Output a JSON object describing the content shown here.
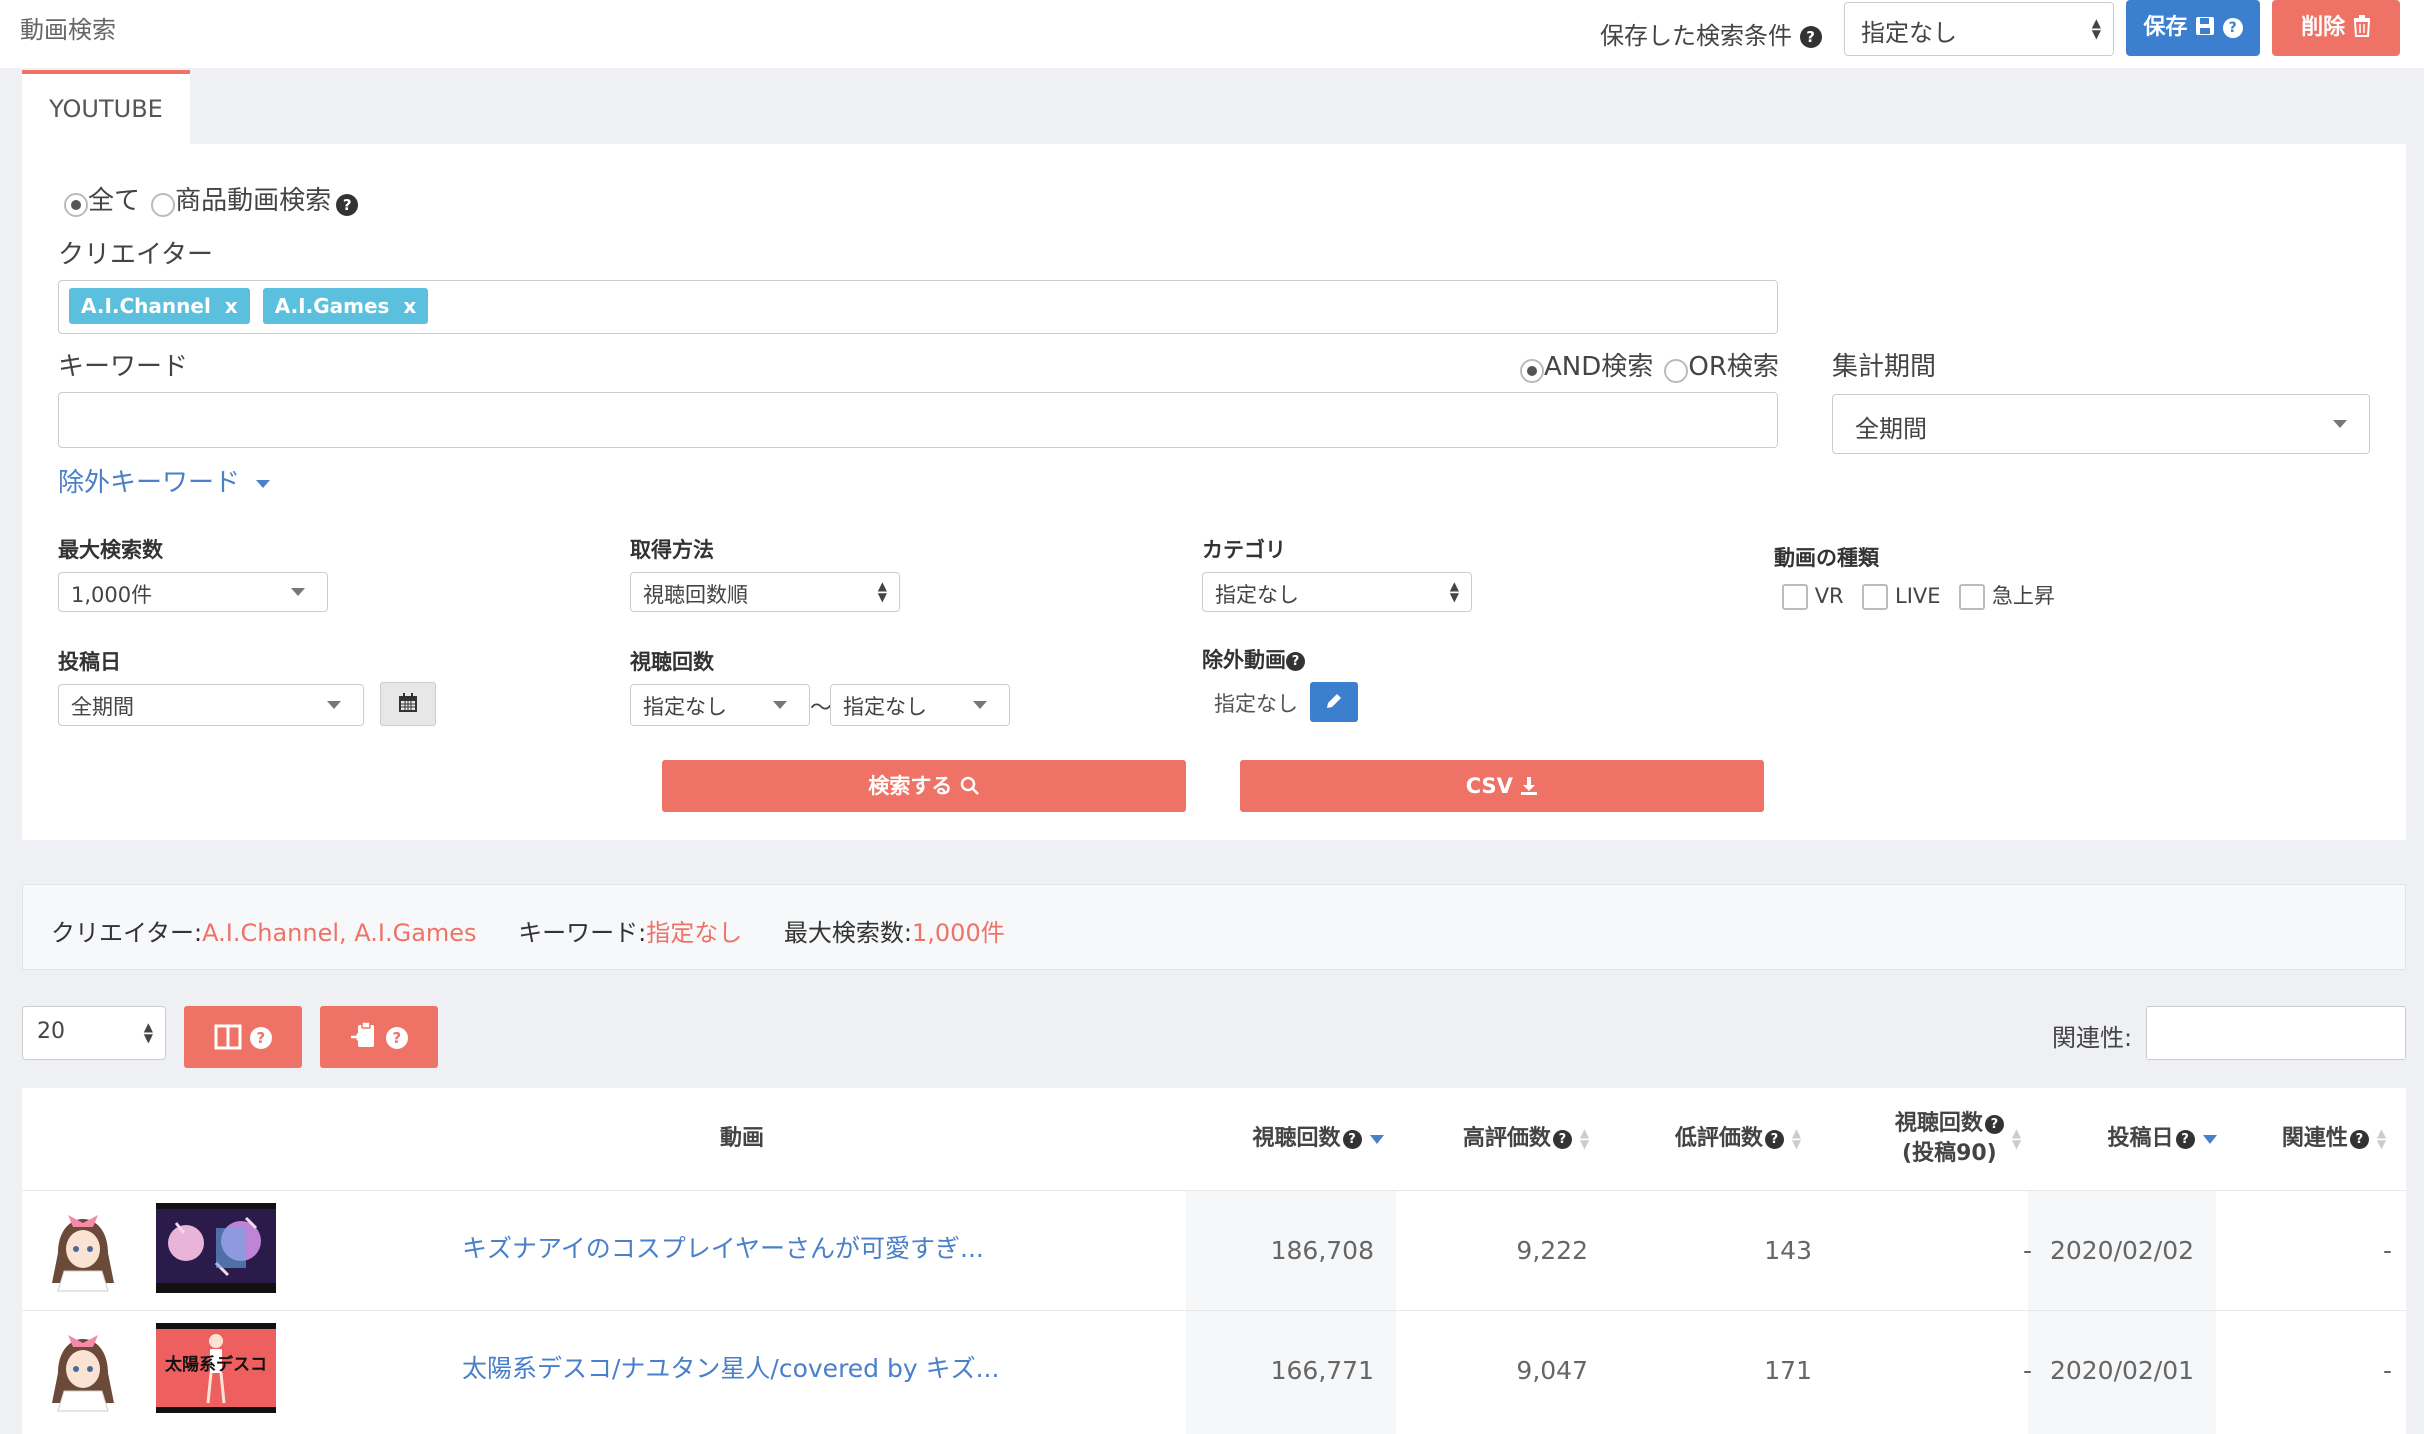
{
  "header": {
    "page_title": "動画検索",
    "saved_conditions_label": "保存した検索条件",
    "saved_conditions_value": "指定なし",
    "save_label": "保存",
    "delete_label": "削除"
  },
  "tab": {
    "label": "YOUTUBE"
  },
  "search": {
    "mode_all": "全て",
    "mode_product": "商品動画検索",
    "creator_label": "クリエイター",
    "creator_tags": [
      "A.I.Channel",
      "A.I.Games"
    ],
    "tag_remove": "x",
    "keyword_label": "キーワード",
    "keyword_value": "",
    "and_label": "AND検索",
    "or_label": "OR検索",
    "period_label": "集計期間",
    "period_value": "全期間",
    "exclude_keyword_label": "除外キーワード",
    "max_results_label": "最大検索数",
    "max_results_value": "1,000件",
    "method_label": "取得方法",
    "method_value": "視聴回数順",
    "category_label": "カテゴリ",
    "category_value": "指定なし",
    "type_label": "動画の種類",
    "type_vr": "VR",
    "type_live": "LIVE",
    "type_rising": "急上昇",
    "posted_label": "投稿日",
    "posted_value": "全期間",
    "views_label": "視聴回数",
    "views_min": "指定なし",
    "views_sep": "〜",
    "views_max": "指定なし",
    "exclude_videos_label": "除外動画",
    "exclude_videos_value": "指定なし",
    "search_button": "検索する",
    "csv_button": "CSV"
  },
  "summary": {
    "creator_key": "クリエイター:",
    "creator_val": "A.I.Channel, A.I.Games",
    "keyword_key": "キーワード:",
    "keyword_val": "指定なし",
    "max_key": "最大検索数:",
    "max_val": "1,000件"
  },
  "controls": {
    "per_page": "20",
    "relevance_label": "関連性:"
  },
  "table": {
    "headers": {
      "video": "動画",
      "views": "視聴回数",
      "likes": "高評価数",
      "dislikes": "低評価数",
      "views90_line1": "視聴回数",
      "views90_line2": "(投稿90)",
      "posted": "投稿日",
      "relevance": "関連性"
    },
    "rows": [
      {
        "title": "キズナアイのコスプレイヤーさんが可愛すぎ...",
        "views": "186,708",
        "likes": "9,222",
        "dislikes": "143",
        "views90": "-",
        "posted": "2020/02/02",
        "relevance": "-",
        "thumb_text": ""
      },
      {
        "title": "太陽系デスコ/ナユタン星人/covered by キズ...",
        "views": "166,771",
        "likes": "9,047",
        "dislikes": "171",
        "views90": "-",
        "posted": "2020/02/01",
        "relevance": "-",
        "thumb_text": "太陽系デスコ"
      }
    ]
  },
  "colors": {
    "accent": "#ee7366",
    "primary": "#3d7fcf",
    "tag": "#5bc0de",
    "link": "#4a7fc9"
  }
}
